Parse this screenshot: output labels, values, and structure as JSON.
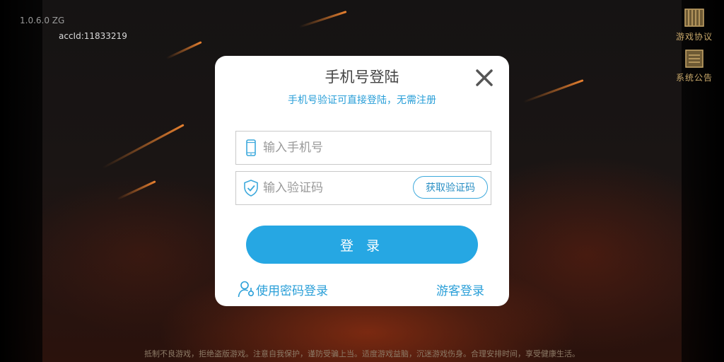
{
  "app": {
    "version": "1.0.6.0 ZG",
    "account_id": "accId:11833219"
  },
  "side_menu": {
    "agreement_label": "游戏协议",
    "notice_label": "系统公告"
  },
  "dialog": {
    "title": "手机号登陆",
    "subtitle": "手机号验证可直接登陆，无需注册",
    "phone_placeholder": "输入手机号",
    "phone_value": "",
    "code_placeholder": "输入验证码",
    "code_value": "",
    "get_code_label": "获取验证码",
    "login_label": "登 录",
    "password_login_label": "使用密码登录",
    "guest_login_label": "游客登录"
  },
  "footer": {
    "notice": "抵制不良游戏，拒绝盗版游戏。注意自我保护，谨防受骗上当。适度游戏益脑，沉迷游戏伤身。合理安排时间，享受健康生活。"
  },
  "colors": {
    "accent": "#26a7e3",
    "accent_text": "#2a9fd8",
    "side_gold": "#c8a86a"
  },
  "icons": [
    "phone-icon",
    "shield-check-icon",
    "user-key-icon",
    "close-icon",
    "scroll-icon",
    "notice-board-icon"
  ]
}
